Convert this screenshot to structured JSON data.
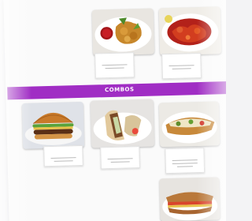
{
  "banner": {
    "label": "COMBOS"
  },
  "items": [
    {
      "name": "",
      "desc_lines": 2
    },
    {
      "name": "",
      "desc_lines": 2
    },
    {
      "name": "",
      "desc_lines": 2
    },
    {
      "name": "",
      "desc_lines": 2
    },
    {
      "name": "",
      "desc_lines": 3
    },
    {
      "name": ""
    }
  ],
  "colors": {
    "banner": "#a02dc4",
    "item_name": "#d2332c",
    "sheet": "#fafafa"
  }
}
